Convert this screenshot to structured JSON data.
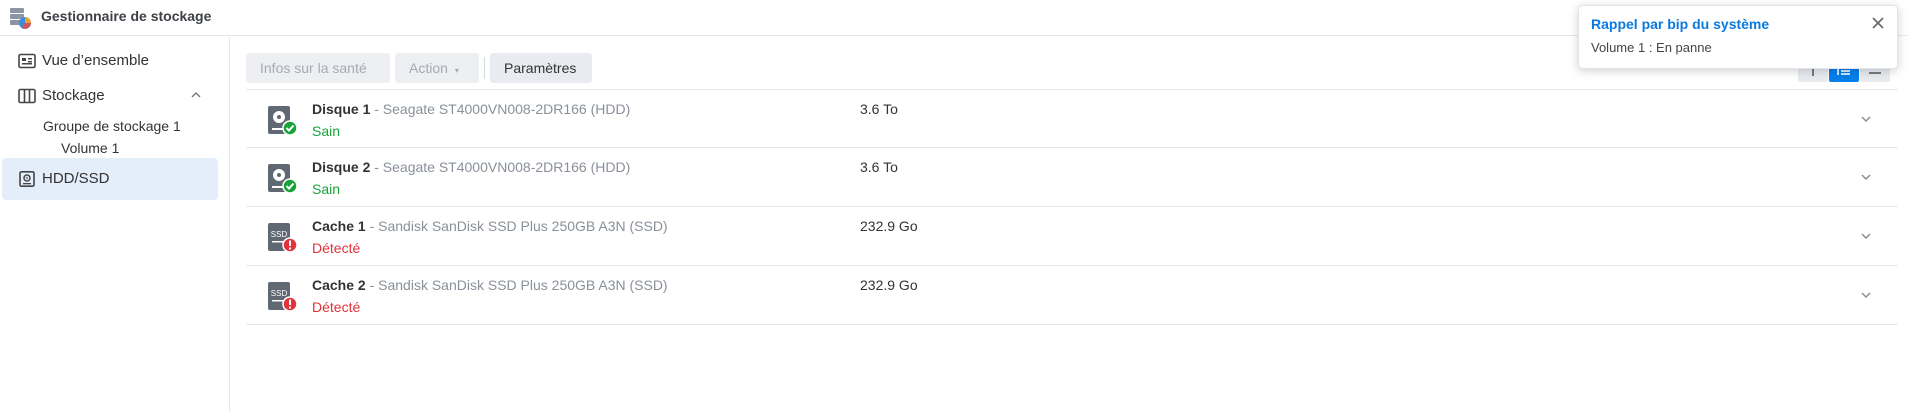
{
  "app": {
    "title": "Gestionnaire de stockage",
    "icon": "storage-manager-icon"
  },
  "sidebar": {
    "items": [
      {
        "label": "Vue d’ensemble",
        "icon": "overview-icon"
      },
      {
        "label": "Stockage",
        "icon": "storage-icon",
        "expanded": true
      },
      {
        "label": "HDD/SSD",
        "icon": "hdd-icon",
        "active": true
      }
    ],
    "storage_pool": "Groupe de stockage 1",
    "volume": "Volume 1"
  },
  "toolbar": {
    "health_info": "Infos sur la santé",
    "action": "Action",
    "settings": "Paramètres"
  },
  "disks": [
    {
      "name": "Disque 1",
      "model": " - Seagate ST4000VN008-2DR166 (HDD)",
      "status": "Sain",
      "status_type": "ok",
      "size": "3.6 To",
      "type": "hdd"
    },
    {
      "name": "Disque 2",
      "model": " - Seagate ST4000VN008-2DR166 (HDD)",
      "status": "Sain",
      "status_type": "ok",
      "size": "3.6 To",
      "type": "hdd"
    },
    {
      "name": "Cache 1",
      "model": " - Sandisk SanDisk SSD Plus 250GB A3N (SSD)",
      "status": "Détecté",
      "status_type": "bad",
      "size": "232.9 Go",
      "type": "ssd"
    },
    {
      "name": "Cache 2",
      "model": " - Sandisk SanDisk SSD Plus 250GB A3N (SSD)",
      "status": "Détecté",
      "status_type": "bad",
      "size": "232.9 Go",
      "type": "ssd"
    }
  ],
  "ssd_badge": "SSD",
  "notification": {
    "title": "Rappel par bip du système",
    "body": "Volume 1 : En panne"
  },
  "colors": {
    "accent": "#057feb",
    "ok": "#19a23a",
    "error": "#e2333a",
    "active_bg": "#e4eefb"
  }
}
